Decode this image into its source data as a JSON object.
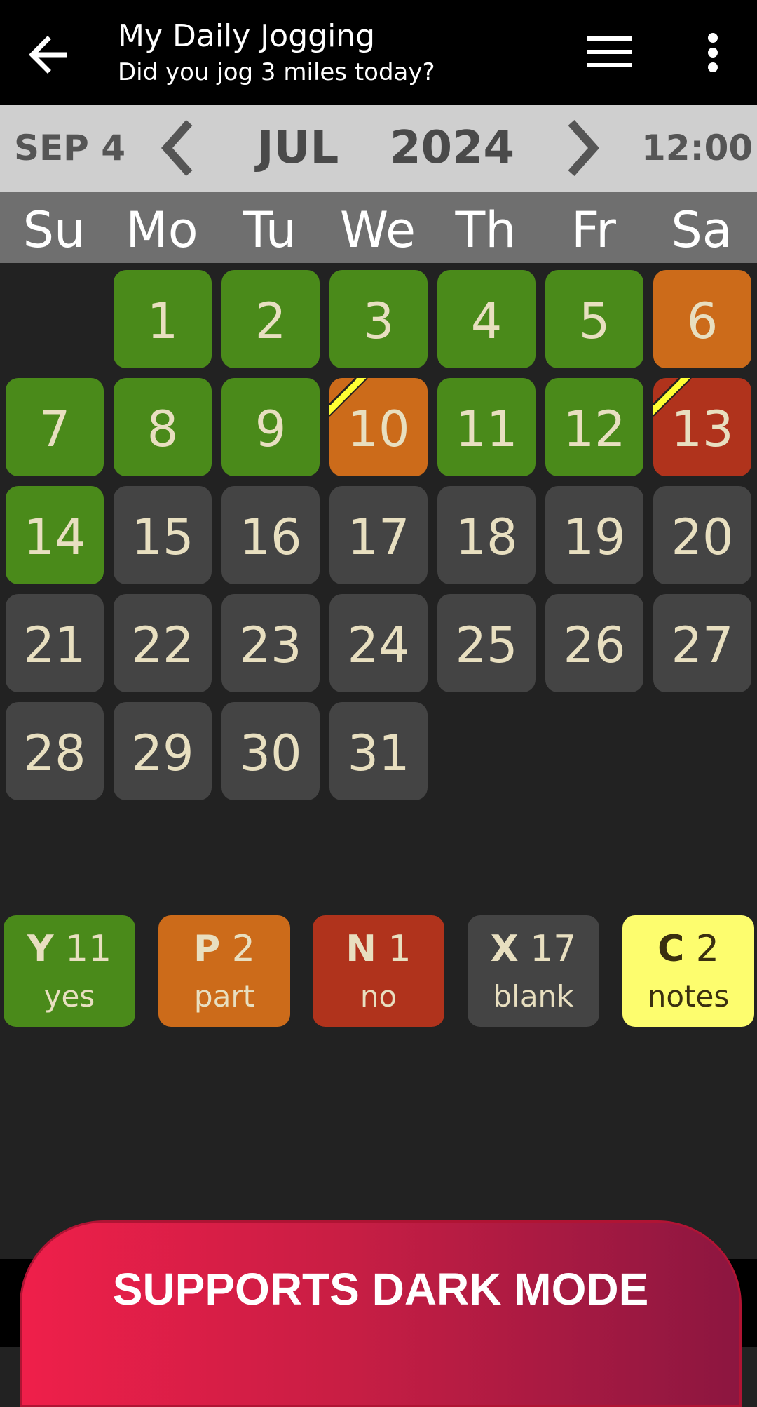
{
  "app_bar": {
    "title": "My Daily Jogging",
    "subtitle": "Did you jog 3 miles today?"
  },
  "date_nav": {
    "today_label": "SEP 4",
    "month": "JUL",
    "year": "2024",
    "time": "12:00"
  },
  "weekdays": [
    "Su",
    "Mo",
    "Tu",
    "We",
    "Th",
    "Fr",
    "Sa"
  ],
  "calendar": {
    "days": [
      {
        "day": "1",
        "status": "green",
        "note": false
      },
      {
        "day": "2",
        "status": "green",
        "note": false
      },
      {
        "day": "3",
        "status": "green",
        "note": false
      },
      {
        "day": "4",
        "status": "green",
        "note": false
      },
      {
        "day": "5",
        "status": "green",
        "note": false
      },
      {
        "day": "6",
        "status": "orange",
        "note": false
      },
      {
        "day": "7",
        "status": "green",
        "note": false
      },
      {
        "day": "8",
        "status": "green",
        "note": false
      },
      {
        "day": "9",
        "status": "green",
        "note": false
      },
      {
        "day": "10",
        "status": "orange",
        "note": true
      },
      {
        "day": "11",
        "status": "green",
        "note": false
      },
      {
        "day": "12",
        "status": "green",
        "note": false
      },
      {
        "day": "13",
        "status": "red",
        "note": true
      },
      {
        "day": "14",
        "status": "green",
        "note": false
      },
      {
        "day": "15",
        "status": "gray",
        "note": false
      },
      {
        "day": "16",
        "status": "gray",
        "note": false
      },
      {
        "day": "17",
        "status": "gray",
        "note": false
      },
      {
        "day": "18",
        "status": "gray",
        "note": false
      },
      {
        "day": "19",
        "status": "gray",
        "note": false
      },
      {
        "day": "20",
        "status": "gray",
        "note": false
      },
      {
        "day": "21",
        "status": "gray",
        "note": false
      },
      {
        "day": "22",
        "status": "gray",
        "note": false
      },
      {
        "day": "23",
        "status": "gray",
        "note": false
      },
      {
        "day": "24",
        "status": "gray",
        "note": false
      },
      {
        "day": "25",
        "status": "gray",
        "note": false
      },
      {
        "day": "26",
        "status": "gray",
        "note": false
      },
      {
        "day": "27",
        "status": "gray",
        "note": false
      },
      {
        "day": "28",
        "status": "gray",
        "note": false
      },
      {
        "day": "29",
        "status": "gray",
        "note": false
      },
      {
        "day": "30",
        "status": "gray",
        "note": false
      },
      {
        "day": "31",
        "status": "gray",
        "note": false
      }
    ]
  },
  "summary": [
    {
      "key": "Y",
      "count": "11",
      "label": "yes",
      "status": "green"
    },
    {
      "key": "P",
      "count": "2",
      "label": "part",
      "status": "orange"
    },
    {
      "key": "N",
      "count": "1",
      "label": "no",
      "status": "red"
    },
    {
      "key": "X",
      "count": "17",
      "label": "blank",
      "status": "gray"
    },
    {
      "key": "C",
      "count": "2",
      "label": "notes",
      "status": "yellow"
    }
  ],
  "banner": {
    "text": "SUPPORTS DARK MODE"
  },
  "colors": {
    "yes": "#4a8a1a",
    "part": "#cc6b1a",
    "no": "#b0331c",
    "blank": "#444444",
    "notes": "#fdfd6e",
    "banner_start": "#ef1f4a",
    "banner_end": "#8c1640"
  },
  "icons": {
    "back": "arrow-left-icon",
    "menu": "hamburger-icon",
    "more": "more-vertical-icon",
    "prev": "chevron-left-icon",
    "next": "chevron-right-icon",
    "note": "note-flag-icon"
  }
}
